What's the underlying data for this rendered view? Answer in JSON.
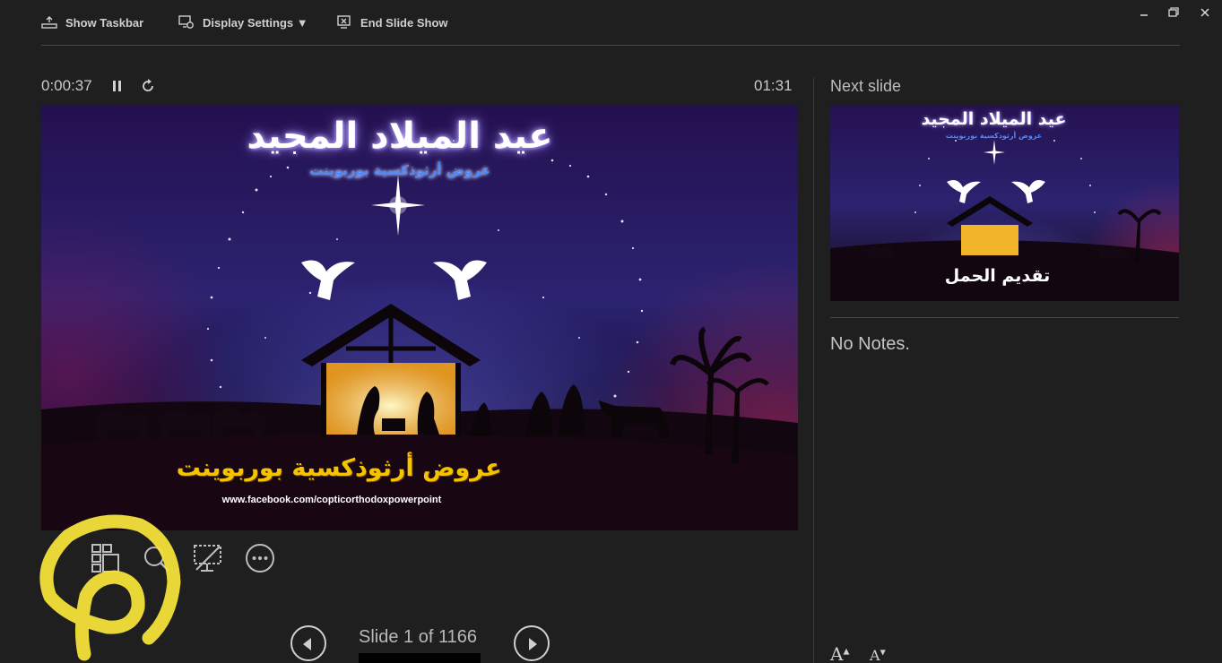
{
  "toolbar": {
    "show_taskbar": "Show Taskbar",
    "display_settings": "Display Settings ▼",
    "end_slide_show": "End Slide Show"
  },
  "presenter": {
    "elapsed_time": "0:00:37",
    "clock": "01:31"
  },
  "current_slide": {
    "title": "عيد الميلاد المجيد",
    "subtitle": "عروض أرثوذكسية بوربوينت",
    "bottom_text": "عروض أرثوذكسية بوربوينت",
    "url": "www.facebook.com/copticorthodoxpowerpoint"
  },
  "navigation": {
    "slide_counter": "Slide 1 of 1166"
  },
  "next_slide": {
    "label": "Next slide",
    "thumb_title": "عيد الميلاد المجيد",
    "thumb_subtitle": "عروض أرثوذكسية بوربوينت",
    "thumb_caption": "تقديم الحمل"
  },
  "notes": {
    "text": "No Notes."
  },
  "font_controls": {
    "increase": "A",
    "decrease": "A"
  },
  "colors": {
    "background": "#1f1f1f",
    "annotation_highlight": "#f4e23a"
  },
  "icons": [
    "taskbar-icon",
    "display-settings-icon",
    "end-show-icon",
    "pause-icon",
    "restart-icon",
    "see-all-slides-icon",
    "zoom-icon",
    "black-screen-icon",
    "more-options-icon",
    "previous-arrow-icon",
    "next-arrow-icon",
    "minimize-icon",
    "restore-icon",
    "close-icon"
  ]
}
